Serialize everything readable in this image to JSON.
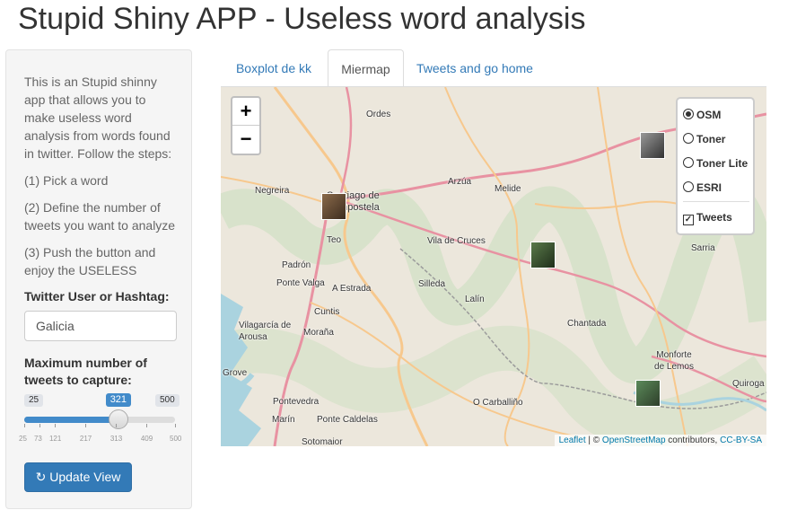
{
  "app": {
    "title": "Stupid Shiny APP - Useless word analysis"
  },
  "sidebar": {
    "intro": "This is an Stupid shinny app that allows you to make useless word analysis from words found in twitter. Follow the steps:",
    "step1": "(1) Pick a word",
    "step2": "(2) Define the number of tweets you want to analyze",
    "step3": "(3) Push the button and enjoy the USELESS",
    "user_label": "Twitter User or Hashtag:",
    "user_value": "Galicia",
    "max_label": "Maximum number of tweets to capture:",
    "slider": {
      "min": 25,
      "max": 500,
      "value": 321,
      "min_text": "25",
      "max_text": "500",
      "value_text": "321",
      "ticks": [
        25,
        73,
        121,
        217,
        313,
        409,
        500
      ],
      "tick_labels": [
        "25",
        "73",
        "121",
        "217",
        "313",
        "409",
        "500"
      ]
    },
    "update_button": "Update View"
  },
  "tabs": [
    {
      "label": "Boxplot de kk",
      "active": false
    },
    {
      "label": "Miermap",
      "active": true
    },
    {
      "label": "Tweets and go home",
      "active": false
    }
  ],
  "map": {
    "zoom_in": "+",
    "zoom_out": "−",
    "places": [
      "Ordes",
      "Negreira",
      "Santiago de Compostela",
      "Arzúa",
      "Melide",
      "Teo",
      "Vila de Cruces",
      "Padrón",
      "Ponte Valga",
      "A Estrada",
      "Silleda",
      "Lalín",
      "Cuntis",
      "Vilagarcía de Arousa",
      "Moraña",
      "Chantada",
      "Monforte de Lemos",
      "Grove",
      "Sarria",
      "Quiroga",
      "Pontevedra",
      "Marín",
      "Ponte Caldelas",
      "O Carballiño",
      "Sotomaior"
    ],
    "layers": {
      "base": [
        "OSM",
        "Toner",
        "Toner Lite",
        "ESRI"
      ],
      "selected": "OSM",
      "overlay": "Tweets",
      "overlay_checked": true
    },
    "attribution": {
      "leaflet": "Leaflet",
      "sep": " | © ",
      "osm": "OpenStreetMap",
      "contrib": " contributors, ",
      "license": "CC-BY-SA"
    }
  },
  "colors": {
    "primary": "#337ab7",
    "slider": "#428bca",
    "map_bg": "#ece7dc",
    "roads": "#e892a2",
    "water": "#aad3df"
  }
}
